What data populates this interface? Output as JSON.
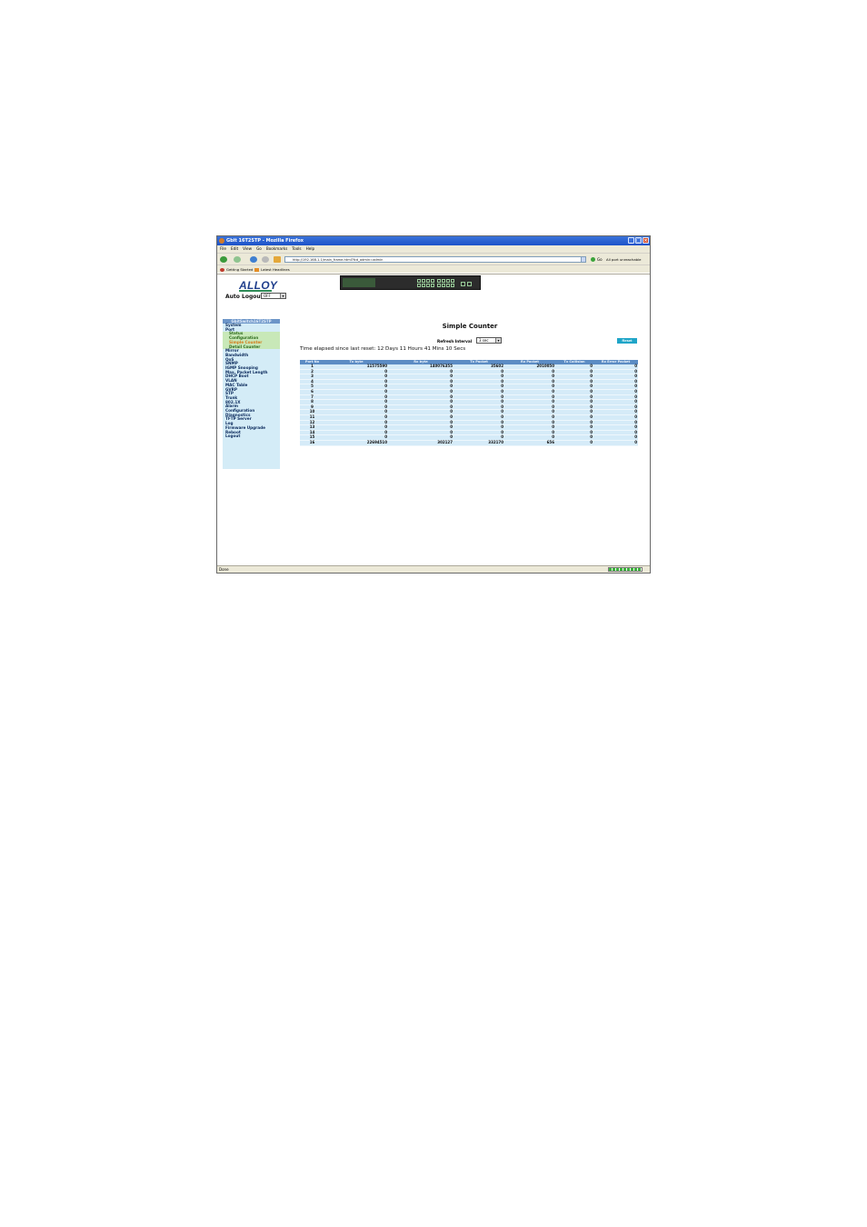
{
  "window": {
    "title": "Gbit 16T2STP - Mozilla Firefox"
  },
  "menu": [
    "File",
    "Edit",
    "View",
    "Go",
    "Bookmarks",
    "Tools",
    "Help"
  ],
  "navbar": {
    "url": "http://192.168.1.1/main_frame.html?fcd_admin=admin",
    "go_label": "Go",
    "status_message": "All port unreachable"
  },
  "bookmarks": [
    "Getting Started",
    "Latest Headlines"
  ],
  "logo": "ALLOY",
  "auto_logout": {
    "label": "Auto Logout",
    "value": "OFF"
  },
  "sidebar": {
    "header": "GbitSwitch16T2STP",
    "items": [
      {
        "label": "System",
        "sub": false,
        "active": false
      },
      {
        "label": "Port",
        "sub": false,
        "active": false
      },
      {
        "label": "Status",
        "sub": true,
        "active": false
      },
      {
        "label": "Configuration",
        "sub": true,
        "active": false
      },
      {
        "label": "Simple Counter",
        "sub": true,
        "active": true
      },
      {
        "label": "Detail Counter",
        "sub": true,
        "active": false
      },
      {
        "label": "Mirror",
        "sub": false,
        "active": false
      },
      {
        "label": "Bandwidth",
        "sub": false,
        "active": false
      },
      {
        "label": "QoS",
        "sub": false,
        "active": false
      },
      {
        "label": "SNMP",
        "sub": false,
        "active": false
      },
      {
        "label": "IGMP Snooping",
        "sub": false,
        "active": false
      },
      {
        "label": "Max. Packet Length",
        "sub": false,
        "active": false
      },
      {
        "label": "DHCP Boot",
        "sub": false,
        "active": false
      },
      {
        "label": "VLAN",
        "sub": false,
        "active": false
      },
      {
        "label": "MAC Table",
        "sub": false,
        "active": false
      },
      {
        "label": "GVRP",
        "sub": false,
        "active": false
      },
      {
        "label": "STP",
        "sub": false,
        "active": false
      },
      {
        "label": "Trunk",
        "sub": false,
        "active": false
      },
      {
        "label": "802.1X",
        "sub": false,
        "active": false
      },
      {
        "label": "Alarm",
        "sub": false,
        "active": false
      },
      {
        "label": "Configuration",
        "sub": false,
        "active": false
      },
      {
        "label": "Diagnostics",
        "sub": false,
        "active": false
      },
      {
        "label": "TFTP Server",
        "sub": false,
        "active": false
      },
      {
        "label": "Log",
        "sub": false,
        "active": false
      },
      {
        "label": "Firmware Upgrade",
        "sub": false,
        "active": false
      },
      {
        "label": "Reboot",
        "sub": false,
        "active": false
      },
      {
        "label": "Logout",
        "sub": false,
        "active": false
      }
    ]
  },
  "main": {
    "title": "Simple Counter",
    "refresh_label": "Refresh Interval",
    "refresh_value": "3 sec",
    "reset_label": "Reset",
    "elapsed": "Time elapsed since last reset: 12 Days 11 Hours 41 Mins 10 Secs",
    "columns": [
      "Port No",
      "Tx byte",
      "Rx byte",
      "Tx Packet",
      "Rx Packet",
      "Tx Collision",
      "Rx Error Packet"
    ],
    "rows": [
      [
        "1",
        "11575590",
        "140076355",
        "35602",
        "2010050",
        "0",
        "0"
      ],
      [
        "2",
        "0",
        "0",
        "0",
        "0",
        "0",
        "0"
      ],
      [
        "3",
        "0",
        "0",
        "0",
        "0",
        "0",
        "0"
      ],
      [
        "4",
        "0",
        "0",
        "0",
        "0",
        "0",
        "0"
      ],
      [
        "5",
        "0",
        "0",
        "0",
        "0",
        "0",
        "0"
      ],
      [
        "6",
        "0",
        "0",
        "0",
        "0",
        "0",
        "0"
      ],
      [
        "7",
        "0",
        "0",
        "0",
        "0",
        "0",
        "0"
      ],
      [
        "8",
        "0",
        "0",
        "0",
        "0",
        "0",
        "0"
      ],
      [
        "9",
        "0",
        "0",
        "0",
        "0",
        "0",
        "0"
      ],
      [
        "10",
        "0",
        "0",
        "0",
        "0",
        "0",
        "0"
      ],
      [
        "11",
        "0",
        "0",
        "0",
        "0",
        "0",
        "0"
      ],
      [
        "12",
        "0",
        "0",
        "0",
        "0",
        "0",
        "0"
      ],
      [
        "13",
        "0",
        "0",
        "0",
        "0",
        "0",
        "0"
      ],
      [
        "14",
        "0",
        "0",
        "0",
        "0",
        "0",
        "0"
      ],
      [
        "15",
        "0",
        "0",
        "0",
        "0",
        "0",
        "0"
      ],
      [
        "16",
        "22694510",
        "302127",
        "332170",
        "656",
        "0",
        "0"
      ]
    ]
  },
  "statusbar": {
    "text": "Done"
  },
  "colors": {
    "accent": "#5c8cc4",
    "sidebar_bg": "#d4ecf7",
    "active_item": "#d37b1a",
    "reset_button": "#1fa5c8"
  }
}
